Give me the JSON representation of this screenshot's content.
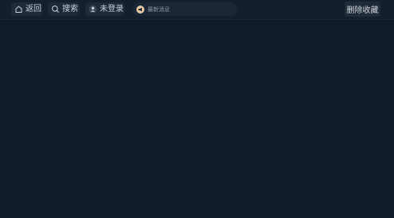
{
  "toolbar": {
    "back_label": "返回",
    "search_label": "搜索",
    "login_label": "未登录",
    "notice_text": "最新消息",
    "remove_favorite_label": "删除收藏"
  },
  "icons": {
    "back": "home-icon",
    "search": "search-icon",
    "login": "user-icon",
    "notice": "megaphone-icon"
  },
  "colors": {
    "background": "#111b28",
    "topbar": "#131f2d",
    "pill": "#1d2a3a",
    "notice_dot": "#e8c9a4"
  }
}
